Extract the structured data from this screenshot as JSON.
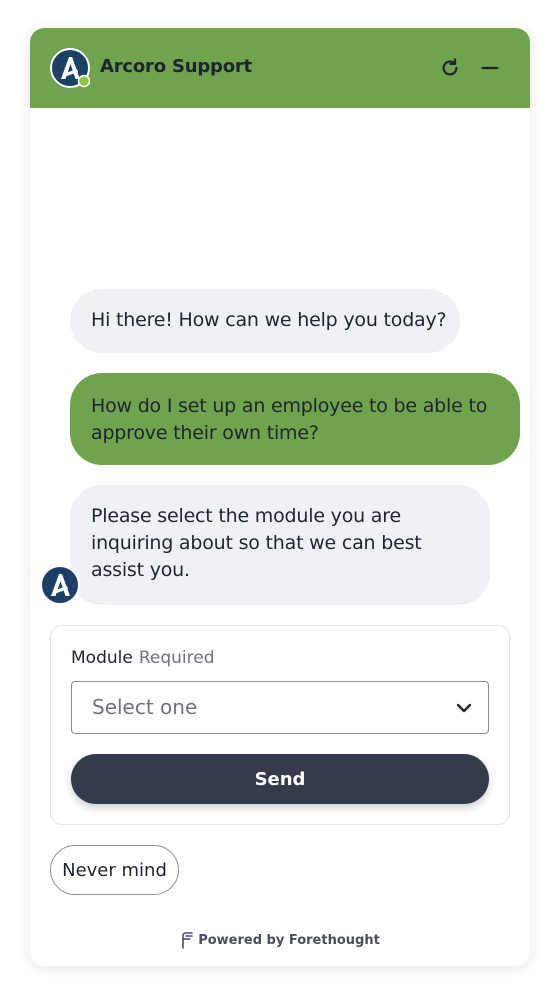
{
  "header": {
    "title": "Arcoro Support",
    "brand_color": "#6fa34d",
    "logo_icon": "arcoro-logo-icon",
    "refresh_icon": "refresh-icon",
    "minimize_icon": "minimize-icon"
  },
  "messages": [
    {
      "role": "bot",
      "text": "Hi there! How can we help you today?"
    },
    {
      "role": "user",
      "text": "How do I set up an employee to be able to approve their own time?"
    },
    {
      "role": "bot",
      "text": "Please select the module you are inquiring about so that we can best assist you."
    }
  ],
  "form": {
    "label": "Module",
    "required_text": "Required",
    "select_placeholder": "Select one",
    "send_label": "Send"
  },
  "actions": {
    "never_mind_label": "Never mind"
  },
  "footer": {
    "powered_text": "Powered by Forethought"
  },
  "colors": {
    "user_bubble": "#6fa34d",
    "bot_bubble": "#f0f1f5",
    "send_button": "#363a4d"
  }
}
